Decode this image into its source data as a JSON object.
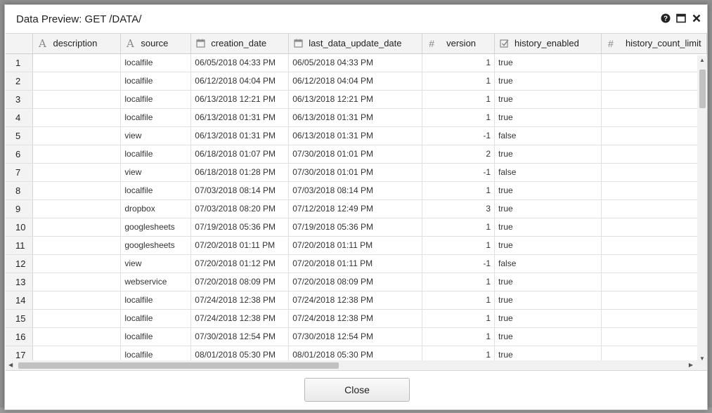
{
  "dialog": {
    "title": "Data Preview: GET /DATA/",
    "close_button_label": "Close"
  },
  "table": {
    "columns": [
      {
        "label": "description",
        "type_icon": "text-type-icon"
      },
      {
        "label": "source",
        "type_icon": "text-type-icon"
      },
      {
        "label": "creation_date",
        "type_icon": "date-type-icon"
      },
      {
        "label": "last_data_update_date",
        "type_icon": "date-type-icon"
      },
      {
        "label": "version",
        "type_icon": "number-type-icon"
      },
      {
        "label": "history_enabled",
        "type_icon": "boolean-type-icon"
      },
      {
        "label": "history_count_limit",
        "type_icon": "number-type-icon"
      }
    ],
    "rows": [
      {
        "n": "1",
        "description": "",
        "source": "localfile",
        "creation_date": "06/05/2018 04:33 PM",
        "last_update": "06/05/2018 04:33 PM",
        "version": "1",
        "history_enabled": "true",
        "history_count_limit": ""
      },
      {
        "n": "2",
        "description": "",
        "source": "localfile",
        "creation_date": "06/12/2018 04:04 PM",
        "last_update": "06/12/2018 04:04 PM",
        "version": "1",
        "history_enabled": "true",
        "history_count_limit": ""
      },
      {
        "n": "3",
        "description": "",
        "source": "localfile",
        "creation_date": "06/13/2018 12:21 PM",
        "last_update": "06/13/2018 12:21 PM",
        "version": "1",
        "history_enabled": "true",
        "history_count_limit": ""
      },
      {
        "n": "4",
        "description": "",
        "source": "localfile",
        "creation_date": "06/13/2018 01:31 PM",
        "last_update": "06/13/2018 01:31 PM",
        "version": "1",
        "history_enabled": "true",
        "history_count_limit": ""
      },
      {
        "n": "5",
        "description": "",
        "source": "view",
        "creation_date": "06/13/2018 01:31 PM",
        "last_update": "06/13/2018 01:31 PM",
        "version": "-1",
        "history_enabled": "false",
        "history_count_limit": ""
      },
      {
        "n": "6",
        "description": "",
        "source": "localfile",
        "creation_date": "06/18/2018 01:07 PM",
        "last_update": "07/30/2018 01:01 PM",
        "version": "2",
        "history_enabled": "true",
        "history_count_limit": ""
      },
      {
        "n": "7",
        "description": "",
        "source": "view",
        "creation_date": "06/18/2018 01:28 PM",
        "last_update": "07/30/2018 01:01 PM",
        "version": "-1",
        "history_enabled": "false",
        "history_count_limit": ""
      },
      {
        "n": "8",
        "description": "",
        "source": "localfile",
        "creation_date": "07/03/2018 08:14 PM",
        "last_update": "07/03/2018 08:14 PM",
        "version": "1",
        "history_enabled": "true",
        "history_count_limit": ""
      },
      {
        "n": "9",
        "description": "",
        "source": "dropbox",
        "creation_date": "07/03/2018 08:20 PM",
        "last_update": "07/12/2018 12:49 PM",
        "version": "3",
        "history_enabled": "true",
        "history_count_limit": ""
      },
      {
        "n": "10",
        "description": "",
        "source": "googlesheets",
        "creation_date": "07/19/2018 05:36 PM",
        "last_update": "07/19/2018 05:36 PM",
        "version": "1",
        "history_enabled": "true",
        "history_count_limit": ""
      },
      {
        "n": "11",
        "description": "",
        "source": "googlesheets",
        "creation_date": "07/20/2018 01:11 PM",
        "last_update": "07/20/2018 01:11 PM",
        "version": "1",
        "history_enabled": "true",
        "history_count_limit": ""
      },
      {
        "n": "12",
        "description": "",
        "source": "view",
        "creation_date": "07/20/2018 01:12 PM",
        "last_update": "07/20/2018 01:11 PM",
        "version": "-1",
        "history_enabled": "false",
        "history_count_limit": ""
      },
      {
        "n": "13",
        "description": "",
        "source": "webservice",
        "creation_date": "07/20/2018 08:09 PM",
        "last_update": "07/20/2018 08:09 PM",
        "version": "1",
        "history_enabled": "true",
        "history_count_limit": ""
      },
      {
        "n": "14",
        "description": "",
        "source": "localfile",
        "creation_date": "07/24/2018 12:38 PM",
        "last_update": "07/24/2018 12:38 PM",
        "version": "1",
        "history_enabled": "true",
        "history_count_limit": ""
      },
      {
        "n": "15",
        "description": "",
        "source": "localfile",
        "creation_date": "07/24/2018 12:38 PM",
        "last_update": "07/24/2018 12:38 PM",
        "version": "1",
        "history_enabled": "true",
        "history_count_limit": ""
      },
      {
        "n": "16",
        "description": "",
        "source": "localfile",
        "creation_date": "07/30/2018 12:54 PM",
        "last_update": "07/30/2018 12:54 PM",
        "version": "1",
        "history_enabled": "true",
        "history_count_limit": ""
      },
      {
        "n": "17",
        "description": "",
        "source": "localfile",
        "creation_date": "08/01/2018 05:30 PM",
        "last_update": "08/01/2018 05:30 PM",
        "version": "1",
        "history_enabled": "true",
        "history_count_limit": ""
      }
    ]
  }
}
